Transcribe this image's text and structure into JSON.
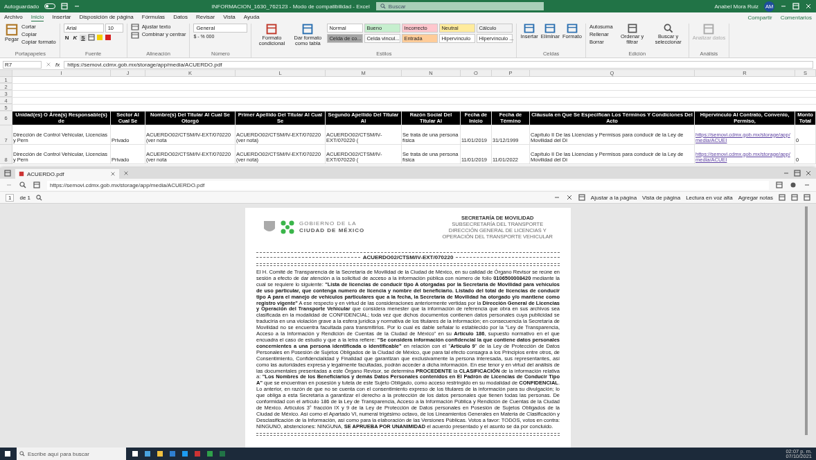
{
  "excel": {
    "title_bar": {
      "autosave": {
        "label": "Autoguardado",
        "on": false
      },
      "title": "INFORMACION_1630_762123  -  Modo de compatibilidad  -  Excel",
      "search": {
        "placeholder": "Buscar"
      },
      "user": "Anabel Mora Ruiz",
      "avatar": "AM"
    },
    "menu": [
      {
        "label": "Archivo",
        "selected": false
      },
      {
        "label": "Inicio",
        "selected": true
      },
      {
        "label": "Insertar",
        "selected": false
      },
      {
        "label": "Disposición de página",
        "selected": false
      },
      {
        "label": "Fórmulas",
        "selected": false
      },
      {
        "label": "Datos",
        "selected": false
      },
      {
        "label": "Revisar",
        "selected": false
      },
      {
        "label": "Vista",
        "selected": false
      },
      {
        "label": "Ayuda",
        "selected": false
      }
    ],
    "share": "Compartir",
    "comments": "Comentarios",
    "ribbon": {
      "clipboard": {
        "label": "Portapapeles",
        "paste": "Pegar",
        "cut": "Cortar",
        "copy": "Copiar",
        "format_painter": "Copiar formato"
      },
      "font": {
        "label": "Fuente",
        "family": "Arial",
        "size": "10",
        "bold": "N",
        "italic": "K",
        "underline": "S"
      },
      "alignment": {
        "label": "Alineación",
        "wrap": "Ajustar texto",
        "merge": "Combinar y centrar"
      },
      "number": {
        "label": "Número",
        "format": "General",
        "symbols": "$ - % 000"
      },
      "styles": {
        "label": "Estilos",
        "conditional": "Formato condicional",
        "as_table": "Dar formato como tabla",
        "cells": [
          {
            "label": "Normal",
            "color": "#ffffff"
          },
          {
            "label": "Bueno",
            "color": "#c6efce"
          },
          {
            "label": "Incorrecto",
            "color": "#ffc7ce"
          },
          {
            "label": "Neutral",
            "color": "#ffeb9c"
          },
          {
            "label": "Cálculo",
            "color": "#f2f2f2"
          },
          {
            "label": "Celda de co...",
            "color": "#a5a5a5"
          },
          {
            "label": "Celda vincul...",
            "color": "#fafafa"
          },
          {
            "label": "Entrada",
            "color": "#ffcc99"
          },
          {
            "label": "Hipervínculo",
            "color": "#ffffff"
          },
          {
            "label": "Hipervínculo ...",
            "color": "#fdfdfd"
          }
        ]
      },
      "cells": {
        "label": "Celdas",
        "items": [
          "Insertar",
          "Eliminar",
          "Formato"
        ]
      },
      "editing": {
        "label": "Edición",
        "autosum": "Autosuma",
        "fill": "Rellenar",
        "clear": "Borrar",
        "sort": "Ordenar y filtrar",
        "find": "Buscar y seleccionar"
      },
      "analysis": {
        "label": "Análisis",
        "item": "Analizar datos"
      }
    },
    "formula_bar": {
      "cell": "R7",
      "fx": "fx",
      "formula": "https://semovi.cdmx.gob.mx/storage/app/media/ACUERDO.pdf"
    },
    "sheet": {
      "columns": [
        "I",
        "J",
        "K",
        "L",
        "M",
        "N",
        "O",
        "P",
        "Q",
        "R",
        "S"
      ],
      "empty_rows": [
        "1",
        "2",
        "3",
        "4",
        "5"
      ],
      "header_row": {
        "number": "6",
        "cells": [
          "Unidad(es) O Área(s) Responsable(s) de",
          "Sector Al Cual Se",
          "Nombre(s) Del Titular Al Cual Se Otorgó",
          "Primer Apellido Del Titular Al Cual Se",
          "Segundo Apellido Del Titular Al",
          "Razón Social Del Titular Al",
          "Fecha de Inicio",
          "Fecha de Término",
          "Cláusula en Que Se Especifican Los Términos Y Condiciones Del Acto",
          "Hipervínculo Al Contrato, Convenio, Permiso,",
          "Monto Total"
        ]
      },
      "rows": [
        {
          "number": "7",
          "cells": [
            "Dirección de Control Vehicular, Licencias y Pern",
            "Privado",
            "ACUERDO02/CTSM/IV-EXT/070220 (ver nota",
            "ACUERDO02/CTSM/IV-EXT/070220 (ver nota)",
            "ACUERDO02/CTSM/IV-EXT/070220 (",
            "Se trata de una persona física",
            "11/01/2019",
            "31/12/1999",
            "Capítulo II De las Licencias y Permisos para conducir de la Ley de Movilidad del Di",
            "https://semovi.cdmx.gob.mx/storage/app/media/ACUEI",
            "0"
          ]
        },
        {
          "number": "8",
          "cells": [
            "Dirección de Control Vehicular, Licencias y Pern",
            "Privado",
            "ACUERDO02/CTSM/IV-EXT/070220 (ver nota",
            "ACUERDO02/CTSM/IV-EXT/070220 (ver nota)",
            "ACUERDO02/CTSM/IV-EXT/070220 (",
            "Se trata de una persona física",
            "11/01/2019",
            "11/01/2022",
            "Capítulo II De las Licencias y Permisos para conducir de la Ley de Movilidad del Di",
            "https://semovi.cdmx.gob.mx/storage/app/media/ACUEI",
            "0"
          ]
        }
      ]
    }
  },
  "browser": {
    "tab": "ACUERDO.pdf",
    "address": "https://semovi.cdmx.gob.mx/storage/app/media/ACUERDO.pdf",
    "pdf_toolbar": {
      "page": "1",
      "of": "de 1",
      "fit": "Ajustar a la página",
      "page_view": "Vista de página",
      "read_aloud": "Lectura en voz alta",
      "notes": "Agregar notas"
    },
    "document": {
      "logo_line_1": "GOBIERNO DE LA",
      "logo_line_2": "CIUDAD DE MÉXICO",
      "agency": [
        "SECRETARÍA DE MOVILIDAD",
        "SUBSECRETARÍA DEL TRANSPORTE",
        "DIRECCIÓN GENERAL DE LICENCIAS Y",
        "OPERACIÓN DEL TRANSPORTE VEHICULAR"
      ],
      "title": "ACUERDO02/CTSM/IV-EXT/070220",
      "body": "El H. Comité de Transparencia de la Secretaría de Movilidad de la Ciudad de México, en su calidad de Órgano Revisor se reúne en sesión a efecto de dar atención a la solicitud de acceso a la información pública con número de folio **0106500008420** mediante la cual se requiere lo siguiente: **\"Lista de licencias de conducir tipo A otorgadas por la Secretaría de Movilidad para vehículos de uso particular, que contenga numero de licencia y nombre del beneficiario. Listado del total de licencias de conducir tipo A para el manejo de vehículos particulares que a la fecha, la Secretaría de Movilidad ha otorgado y/o mantiene como registro vigente\"** A ese respecto y en virtud de las consideraciones anteriormente vertidas por la **Dirección General de Licencias y Operación del Transporte Vehicular** que considera menester que la información de referencia que obra en sus archivos sea clasificada en la modalidad de CONFIDENCIAL; toda vez que dichos documentos contienen datos personales cuya publicidad se traduciría en una violación grave a la esfera jurídica y normativa de los titulares de la información; en consecuencia la Secretaría de Movilidad no se encuentra facultada para transmitirlos. Por lo cual es dable señalar lo establecido por la \"Ley de Transparencia, Acceso a la Información y Rendición de Cuentas de la Ciudad de México\" en su **Artículo 186**, supuesto normativo en el que encuadra el caso de estudio y que a la letra refiere: **\"Se considera información confidencial la que contiene datos personales concernientes a una persona identificada o identificable\"** en relación con el \"**Artículo 9**\" de la Ley de Protección de Datos Personales en Posesión de Sujetos Obligados de la Ciudad de México, que para tal efecto consagra a los Principios entre otros, de Consentimiento, Confidencialidad y Finalidad que garantizan que exclusivamente la persona interesada, sus representantes, así como las autoridades expresa y legalmente facultadas, podrán acceder a dicha información. En ese tenor y en virtud del análisis de las documentales presentadas a este Órgano Revisor, se determina **PROCEDENTE** la **CLASIFICACIÓN** de la información relativa a: **\"Los Nombres de los Beneficiarios y demás Datos Personales contenidos en El Padrón de Licencias de Conducir Tipo A\"** que se encuentran en posesión y tutela de este Sujeto Obligado, como acceso restringido en su modalidad de **CONFIDENCIAL**. Lo anterior, en razón de que no se cuenta con el consentimiento expreso de los titulares de la información para su divulgación; lo que obliga a esta Secretaría a garantizar el derecho a la protección de los datos personales que tienen todas las personas. De conformidad con el artículo 186 de la Ley de Transparencia, Acceso a la Información Pública y Rendición de Cuentas de la Ciudad de México. Artículos 3° fracción IX y 9 de la Ley de Protección de Datos personales en Posesión de Sujetos Obligados de la Ciudad de México. Así como el Apartado VI, numeral trigésimo octavo, de los Lineamientos Generales en Materia de Clasificación y Desclasificación de la Información, así como para la elaboración de las Versiones Públicas. Votos a favor: TODOS, votos en contra: NINGUNO, abstenciones: NINGUNA, **SE APRUEBA POR UNANIMIDAD** el acuerdo presentado y el asunto se da por concluido."
    }
  },
  "taskbar": {
    "search": {
      "placeholder": "Escribe aquí para buscar"
    },
    "time": "02:07 p. m.",
    "date": "07/10/2021"
  }
}
